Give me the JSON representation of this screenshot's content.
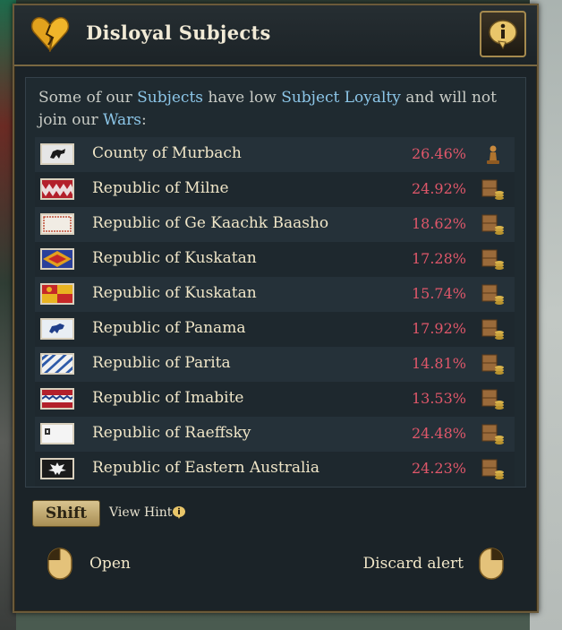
{
  "window": {
    "title": "Disloyal Subjects"
  },
  "description": {
    "part1": "Some of our ",
    "kw1": "Subjects",
    "part2": " have low ",
    "kw2": "Subject Loyalty",
    "part3": " and will not join our ",
    "kw3": "Wars",
    "part4": ":"
  },
  "subjects": [
    {
      "name": "County of Murbach",
      "loyalty": "26.46%",
      "icon": "pawn-icon"
    },
    {
      "name": "Republic of Milne",
      "loyalty": "24.92%",
      "icon": "coins-crate-icon"
    },
    {
      "name": "Republic of Ge Kaachk Baasho",
      "loyalty": "18.62%",
      "icon": "coins-crate-icon"
    },
    {
      "name": "Republic of Kuskatan",
      "loyalty": "17.28%",
      "icon": "coins-crate-icon"
    },
    {
      "name": "Republic of Kuskatan",
      "loyalty": "15.74%",
      "icon": "coins-crate-icon"
    },
    {
      "name": "Republic of Panama",
      "loyalty": "17.92%",
      "icon": "coins-crate-icon"
    },
    {
      "name": "Republic of Parita",
      "loyalty": "14.81%",
      "icon": "coins-crate-icon"
    },
    {
      "name": "Republic of Imabite",
      "loyalty": "13.53%",
      "icon": "coins-crate-icon"
    },
    {
      "name": "Republic of Raeffsky",
      "loyalty": "24.48%",
      "icon": "coins-crate-icon"
    },
    {
      "name": "Republic of Eastern Australia",
      "loyalty": "24.23%",
      "icon": "coins-crate-icon"
    }
  ],
  "footer": {
    "shift_key": "Shift",
    "view_hint": "View Hint",
    "open_label": "Open",
    "discard_label": "Discard alert"
  },
  "colors": {
    "accent_keyword": "#8cc6e8",
    "loyalty_low": "#e0576a",
    "gold_border": "#7a6842"
  }
}
